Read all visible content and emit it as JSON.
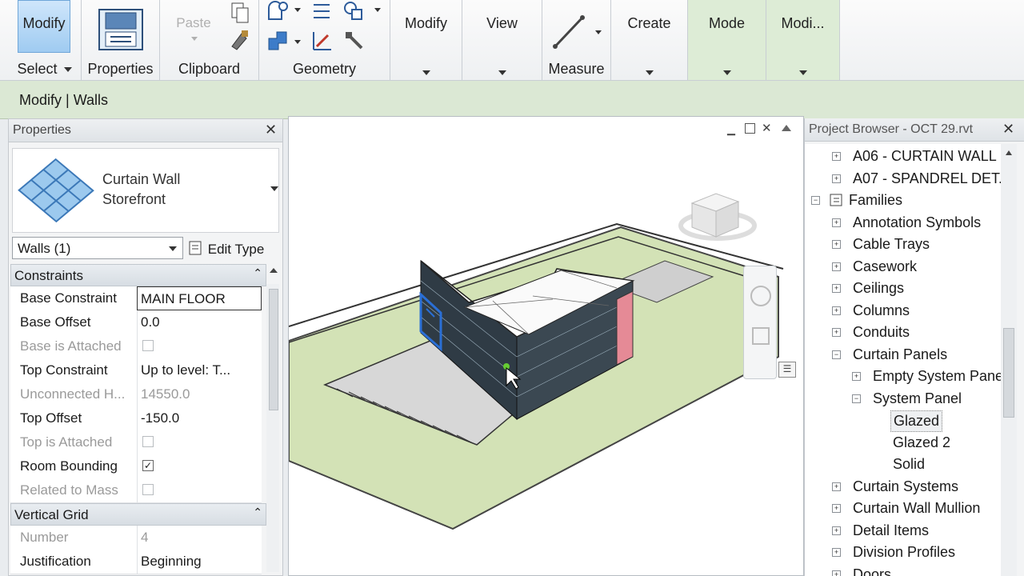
{
  "ribbon": {
    "modify_label": "Modify",
    "select_label": "Select",
    "properties_label": "Properties",
    "paste_label": "Paste",
    "clipboard_label": "Clipboard",
    "geometry_label": "Geometry",
    "modify2_label": "Modify",
    "view_label": "View",
    "measure_label": "Measure",
    "create_label": "Create",
    "mode_label": "Mode",
    "modify3_label": "Modi..."
  },
  "context_bar": {
    "title": "Modify | Walls"
  },
  "properties": {
    "title": "Properties",
    "type_line1": "Curtain Wall",
    "type_line2": "Storefront",
    "instance_selector": "Walls (1)",
    "edit_type": "Edit Type",
    "groups": {
      "constraints": "Constraints",
      "vertical_grid": "Vertical Grid"
    },
    "rows": [
      {
        "name": "Base Constraint",
        "value": "MAIN FLOOR"
      },
      {
        "name": "Base Offset",
        "value": "0.0"
      },
      {
        "name": "Base is Attached",
        "value": ""
      },
      {
        "name": "Top Constraint",
        "value": "Up to level: T..."
      },
      {
        "name": "Unconnected H...",
        "value": "14550.0"
      },
      {
        "name": "Top Offset",
        "value": "-150.0"
      },
      {
        "name": "Top is Attached",
        "value": ""
      },
      {
        "name": "Room Bounding",
        "value": ""
      },
      {
        "name": "Related to Mass",
        "value": ""
      },
      {
        "name": "Number",
        "value": "4"
      },
      {
        "name": "Justification",
        "value": "Beginning"
      }
    ],
    "checkboxes": {
      "base_is_attached": false,
      "top_is_attached": false,
      "room_bounding": true,
      "related_to_mass": false
    }
  },
  "project_browser": {
    "title": "Project Browser - OCT 29.rvt",
    "items": [
      "A06 - CURTAIN WALL",
      "A07 - SPANDREL DET.",
      "Families",
      "Annotation Symbols",
      "Cable Trays",
      "Casework",
      "Ceilings",
      "Columns",
      "Conduits",
      "Curtain Panels",
      "Empty System Pane",
      "System Panel",
      "Glazed",
      "Glazed 2",
      "Solid",
      "Curtain Systems",
      "Curtain Wall Mullion",
      "Detail Items",
      "Division Profiles",
      "Doors"
    ]
  },
  "colors": {
    "context_green": "#dbe8d4",
    "ground_green": "#d3e2b6",
    "panel_red": "#e58a96",
    "selection_blue": "#2a6fd6"
  }
}
